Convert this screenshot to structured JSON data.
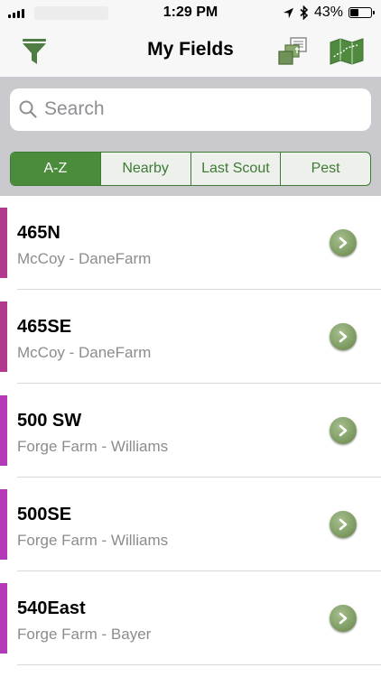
{
  "status_bar": {
    "time": "1:29 PM",
    "battery": "43%",
    "battery_level": 0.43
  },
  "nav": {
    "title": "My Fields",
    "filter_icon": "filter-icon",
    "copy_icon": "copy-fields-icon",
    "map_icon": "map-icon"
  },
  "search": {
    "placeholder": "Search"
  },
  "sort_tabs": [
    {
      "label": "A-Z",
      "active": true
    },
    {
      "label": "Nearby",
      "active": false
    },
    {
      "label": "Last Scout",
      "active": false
    },
    {
      "label": "Pest",
      "active": false
    }
  ],
  "fields": [
    {
      "name": "465N",
      "farm": "McCoy - DaneFarm",
      "color": "#b23a8e"
    },
    {
      "name": "465SE",
      "farm": "McCoy - DaneFarm",
      "color": "#b23a8e"
    },
    {
      "name": "500 SW",
      "farm": "Forge Farm - Williams",
      "color": "#b43ab8"
    },
    {
      "name": "500SE",
      "farm": "Forge Farm - Williams",
      "color": "#b43ab8"
    },
    {
      "name": "540East",
      "farm": "Forge Farm - Bayer",
      "color": "#b43ab8"
    }
  ],
  "colors": {
    "accent": "#4b8b3c",
    "nav_icon": "#4f7d43",
    "chevron": "#7c9a62"
  }
}
